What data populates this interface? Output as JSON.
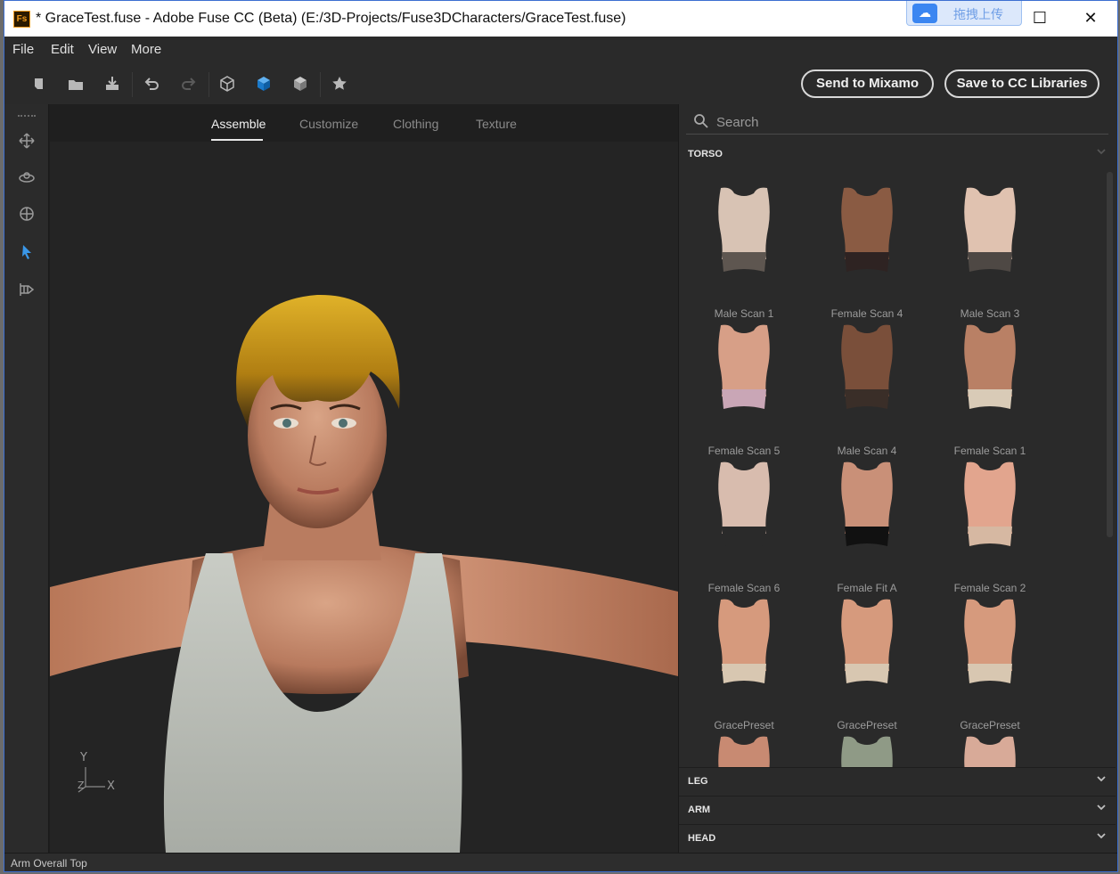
{
  "window": {
    "app_icon": "Fs",
    "title": "* GraceTest.fuse - Adobe Fuse CC (Beta) (E:/3D-Projects/Fuse3DCharacters/GraceTest.fuse)",
    "cloud_upload_label": "拖拽上传",
    "minimize_glyph": "—",
    "maximize_glyph": "☐",
    "close_glyph": "✕"
  },
  "menu": [
    "File",
    "Edit",
    "View",
    "More"
  ],
  "toolbar": {
    "icons": [
      "new-icon",
      "open-icon",
      "save-icon",
      "undo-icon",
      "redo-icon",
      "wireframe-cube-icon",
      "solid-cube-icon",
      "shaded-cube-icon",
      "favorite-icon"
    ],
    "send_label": "Send to Mixamo",
    "save_cc_label": "Save to CC Libraries"
  },
  "left_tools": [
    "move-icon",
    "orbit-icon",
    "target-icon",
    "select-arrow-icon",
    "grid-view-icon"
  ],
  "tabs": [
    {
      "label": "Assemble",
      "active": true
    },
    {
      "label": "Customize",
      "active": false
    },
    {
      "label": "Clothing",
      "active": false
    },
    {
      "label": "Texture",
      "active": false
    }
  ],
  "viewport": {
    "axis_y": "Y",
    "axis_x": "X",
    "axis_z": "Z"
  },
  "panel": {
    "search_placeholder": "Search",
    "sections": [
      {
        "label": "TORSO",
        "expanded": true
      },
      {
        "label": "LEG",
        "expanded": false
      },
      {
        "label": "ARM",
        "expanded": false
      },
      {
        "label": "HEAD",
        "expanded": false
      }
    ],
    "items": [
      {
        "label": "Male Scan 1",
        "tone": "#d8c3b4",
        "bottom": "#5e5650"
      },
      {
        "label": "Female Scan 4",
        "tone": "#8a5b43",
        "bottom": "#2e2322"
      },
      {
        "label": "Male Scan 3",
        "tone": "#e0c2b0",
        "bottom": "#4e4844"
      },
      {
        "label": "Female Scan 5",
        "tone": "#d79f87",
        "bottom": "#c9a6b6"
      },
      {
        "label": "Male Scan 4",
        "tone": "#7a4f3a",
        "bottom": "#3a2e28"
      },
      {
        "label": "Female Scan 1",
        "tone": "#b98065",
        "bottom": "#d9cbb7"
      },
      {
        "label": "Female Scan 6",
        "tone": "#d8bcae",
        "bottom": "#2a2a2a"
      },
      {
        "label": "Female Fit A",
        "tone": "#c99078",
        "bottom": "#111111"
      },
      {
        "label": "Female Scan 2",
        "tone": "#e2a58e",
        "bottom": "#d6b8a2"
      },
      {
        "label": "GracePreset",
        "tone": "#d69a7d",
        "bottom": "#d8c7b1"
      },
      {
        "label": "GracePreset",
        "tone": "#d69a7d",
        "bottom": "#d8c7b1"
      },
      {
        "label": "GracePreset",
        "tone": "#d69a7d",
        "bottom": "#d8c7b1"
      },
      {
        "label": "",
        "tone": "#c88a72",
        "bottom": "#c88a72"
      },
      {
        "label": "",
        "tone": "#8f9a86",
        "bottom": "#8f9a86"
      },
      {
        "label": "",
        "tone": "#d8aa98",
        "bottom": "#d8aa98"
      }
    ]
  },
  "status": "Arm Overall Top"
}
